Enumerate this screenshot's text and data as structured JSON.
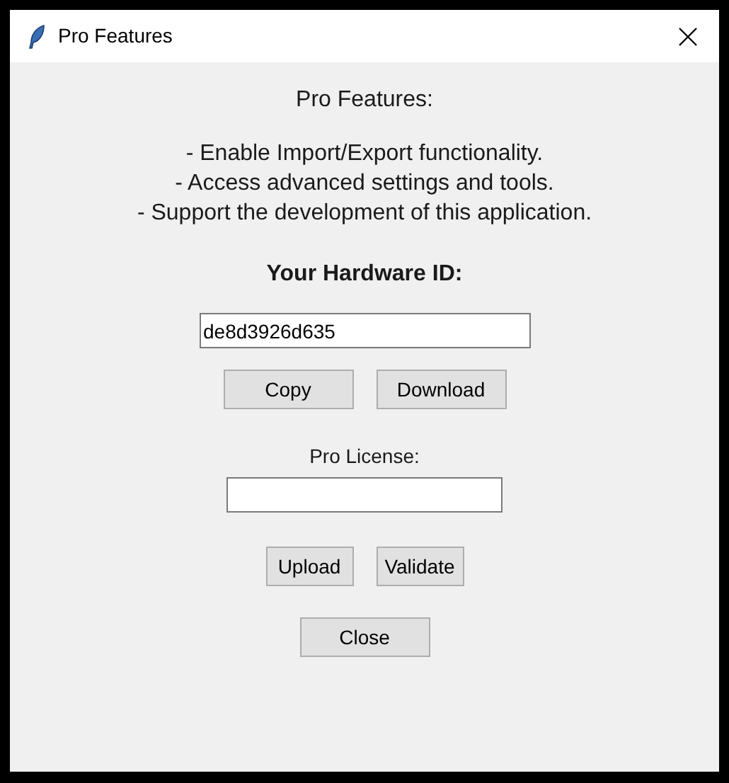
{
  "window": {
    "title": "Pro Features"
  },
  "description": {
    "heading": "Pro Features:",
    "lines": [
      "- Enable Import/Export functionality.",
      "- Access advanced settings and tools.",
      "- Support the development of this application."
    ]
  },
  "hardware_id": {
    "label": "Your Hardware ID:",
    "value": "de8d3926d635"
  },
  "hardware_buttons": [
    "Copy",
    "Download"
  ],
  "license": {
    "label": "Pro License:"
  },
  "license_buttons": [
    "Upload",
    "Validate"
  ],
  "close_button": "Close"
}
